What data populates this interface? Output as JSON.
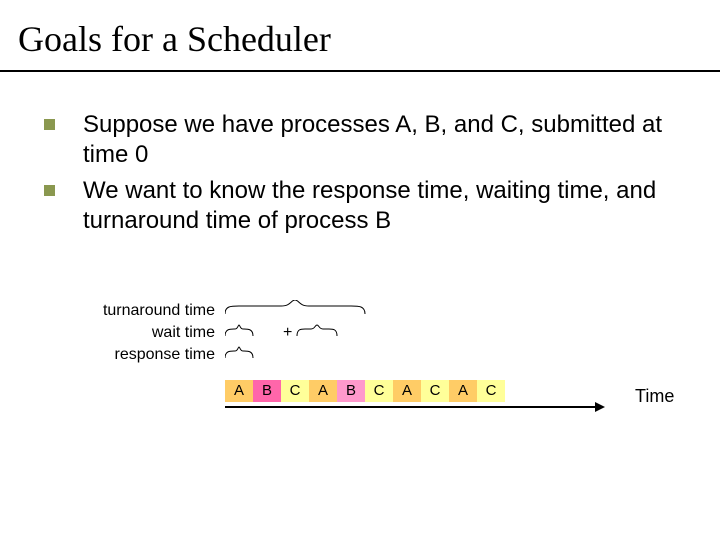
{
  "title": "Goals for a Scheduler",
  "bullets": [
    "Suppose we have processes A, B, and C, submitted at time 0",
    "We want to know the response time, waiting time, and turnaround time of process B"
  ],
  "labels": {
    "turnaround": "turnaround time",
    "wait": "wait time",
    "response": "response time"
  },
  "plus": "+",
  "segments": [
    "A",
    "B",
    "C",
    "A",
    "B",
    "C",
    "A",
    "C",
    "A",
    "C"
  ],
  "axis": "Time"
}
